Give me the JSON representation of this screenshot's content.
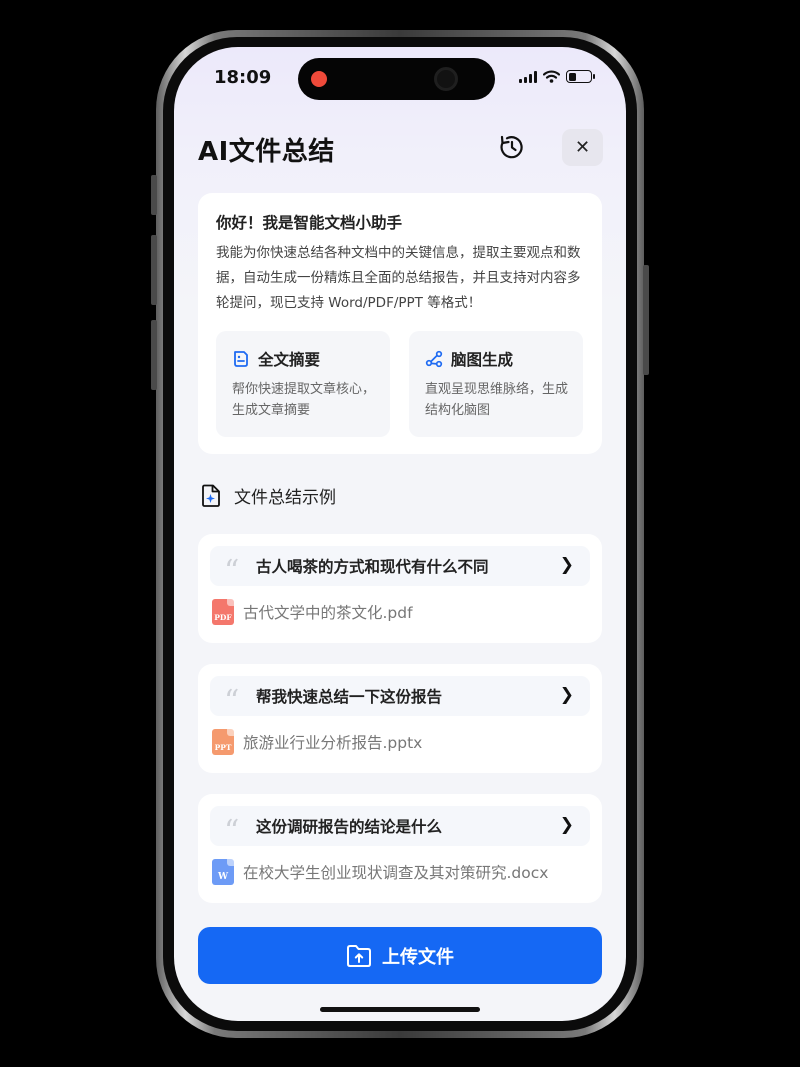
{
  "status_bar": {
    "time": "18:09"
  },
  "header": {
    "title": "AI文件总结",
    "history_icon": "history-clock-icon",
    "close_label": "✕"
  },
  "intro": {
    "title": "你好！我是智能文档小助手",
    "description": "我能为你快速总结各种文档中的关键信息，提取主要观点和数据，自动生成一份精炼且全面的总结报告，并且支持对内容多轮提问，现已支持 Word/PDF/PPT 等格式！",
    "features": [
      {
        "icon": "summary-doc-icon",
        "title": "全文摘要",
        "description": "帮你快速提取文章核心，生成文章摘要"
      },
      {
        "icon": "mindmap-icon",
        "title": "脑图生成",
        "description": "直观呈现思维脉络，生成结构化脑图"
      }
    ]
  },
  "examples_section": {
    "title": "文件总结示例",
    "icon": "file-sparkle-icon",
    "items": [
      {
        "question": "古人喝茶的方式和现代有什么不同",
        "file_name": "古代文学中的茶文化.pdf",
        "file_type": "PDF"
      },
      {
        "question": "帮我快速总结一下这份报告",
        "file_name": "旅游业行业分析报告.pptx",
        "file_type": "PPT"
      },
      {
        "question": "这份调研报告的结论是什么",
        "file_name": "在校大学生创业现状调查及其对策研究.docx",
        "file_type": "W"
      }
    ]
  },
  "upload": {
    "label": "上传文件",
    "icon": "folder-upload-icon"
  },
  "colors": {
    "primary": "#1568f4",
    "pdf": "#f4776c",
    "ppt": "#f59a6e",
    "docx": "#6d9bf6",
    "feature_icon": "#1f6bf2"
  }
}
